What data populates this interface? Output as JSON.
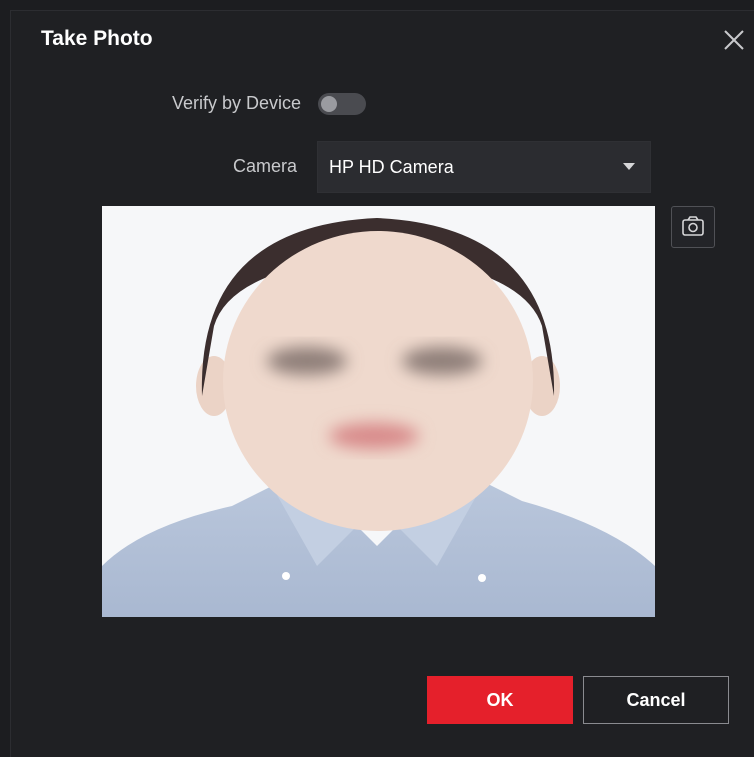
{
  "dialog": {
    "title": "Take Photo",
    "close_icon": "close-icon"
  },
  "verify": {
    "label": "Verify by Device",
    "enabled": false
  },
  "camera": {
    "label": "Camera",
    "value": "HP HD Camera",
    "dropdown_icon": "chevron-down-icon"
  },
  "preview": {
    "icon": "camera-icon"
  },
  "buttons": {
    "ok_label": "OK",
    "cancel_label": "Cancel"
  },
  "colors": {
    "background": "#1f2023",
    "accent": "#e5202b",
    "field": "#2b2c30"
  }
}
